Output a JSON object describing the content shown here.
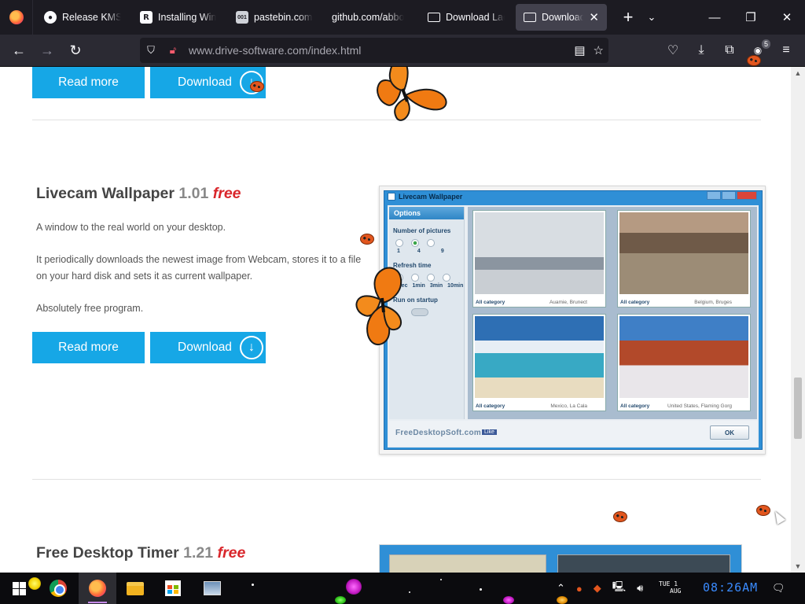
{
  "tabs": [
    {
      "label": "Release KMSp",
      "icon": "github-icon"
    },
    {
      "label": "Installing Win",
      "icon": "r-icon"
    },
    {
      "label": "pastebin.com/",
      "icon": "pastebin-icon"
    },
    {
      "label": "github.com/abbo",
      "icon": "none"
    },
    {
      "label": "Download Lad",
      "icon": "download-page-icon"
    },
    {
      "label": "Download A",
      "icon": "download-page-icon"
    }
  ],
  "url": {
    "host": "www.drive-software.com",
    "path": "/index.html"
  },
  "extensions_badge": "5",
  "buttons": {
    "read_more": "Read more",
    "download": "Download",
    "download_glyph": "↓"
  },
  "products": [
    {
      "name": "Livecam Wallpaper",
      "version": "1.01",
      "price": "free",
      "paragraphs": [
        "A window to the real world on your desktop.",
        "It periodically downloads the newest image from Webcam, stores it to a file on your hard disk and sets it as current wallpaper.",
        "Absolutely free program."
      ]
    },
    {
      "name": "Free Desktop Timer",
      "version": "1.21",
      "price": "free"
    }
  ],
  "screenshot": {
    "window_title": "Livecam Wallpaper",
    "options_title": "Options",
    "number_of_pictures_label": "Number of pictures",
    "number_options": [
      "1",
      "4",
      "9"
    ],
    "refresh_label": "Refresh time",
    "refresh_options": [
      "10sec",
      "1min",
      "3min",
      "10min"
    ],
    "startup_label": "Run on startup",
    "thumbs": [
      {
        "category": "All category",
        "location": "Auamie, Brunect"
      },
      {
        "category": "All category",
        "location": "Belgium, Bruges"
      },
      {
        "category": "All category",
        "location": "Mexico, La Cala"
      },
      {
        "category": "All category",
        "location": "United States, Flaming Gorg"
      }
    ],
    "brand": "FreeDesktopSoft.com",
    "like": "Like",
    "ok": "OK"
  },
  "taskbar": {
    "date_line1": "TUE 1",
    "date_line2": "AUG",
    "time": "08:26AM"
  },
  "colors": {
    "accent": "#16a7e6",
    "free": "#d9262b",
    "chrome_dark": "#1c1b22"
  }
}
